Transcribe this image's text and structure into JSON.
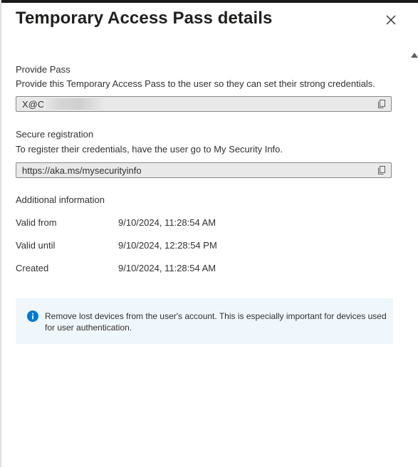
{
  "dialog": {
    "title": "Temporary Access Pass details",
    "close_icon": "close-icon"
  },
  "provide_pass": {
    "label": "Provide Pass",
    "description": "Provide this Temporary Access Pass to the user so they can set their strong credentials.",
    "value": "X@C",
    "copy_icon": "copy-icon"
  },
  "secure_registration": {
    "label": "Secure registration",
    "description": "To register their credentials, have the user go to My Security Info.",
    "value": "https://aka.ms/mysecurityinfo",
    "copy_icon": "copy-icon"
  },
  "additional_info": {
    "label": "Additional information",
    "rows": [
      {
        "label": "Valid from",
        "value": "9/10/2024, 11:28:54 AM"
      },
      {
        "label": "Valid until",
        "value": "9/10/2024, 12:28:54 PM"
      },
      {
        "label": "Created",
        "value": "9/10/2024, 11:28:54 AM"
      }
    ]
  },
  "notice": {
    "icon": "info-icon",
    "text": "Remove lost devices from the user's account. This is especially important for devices used for user authentication."
  },
  "colors": {
    "accent": "#0078d4",
    "notice_background": "#eff6fc",
    "field_background": "#e9e9e9"
  }
}
